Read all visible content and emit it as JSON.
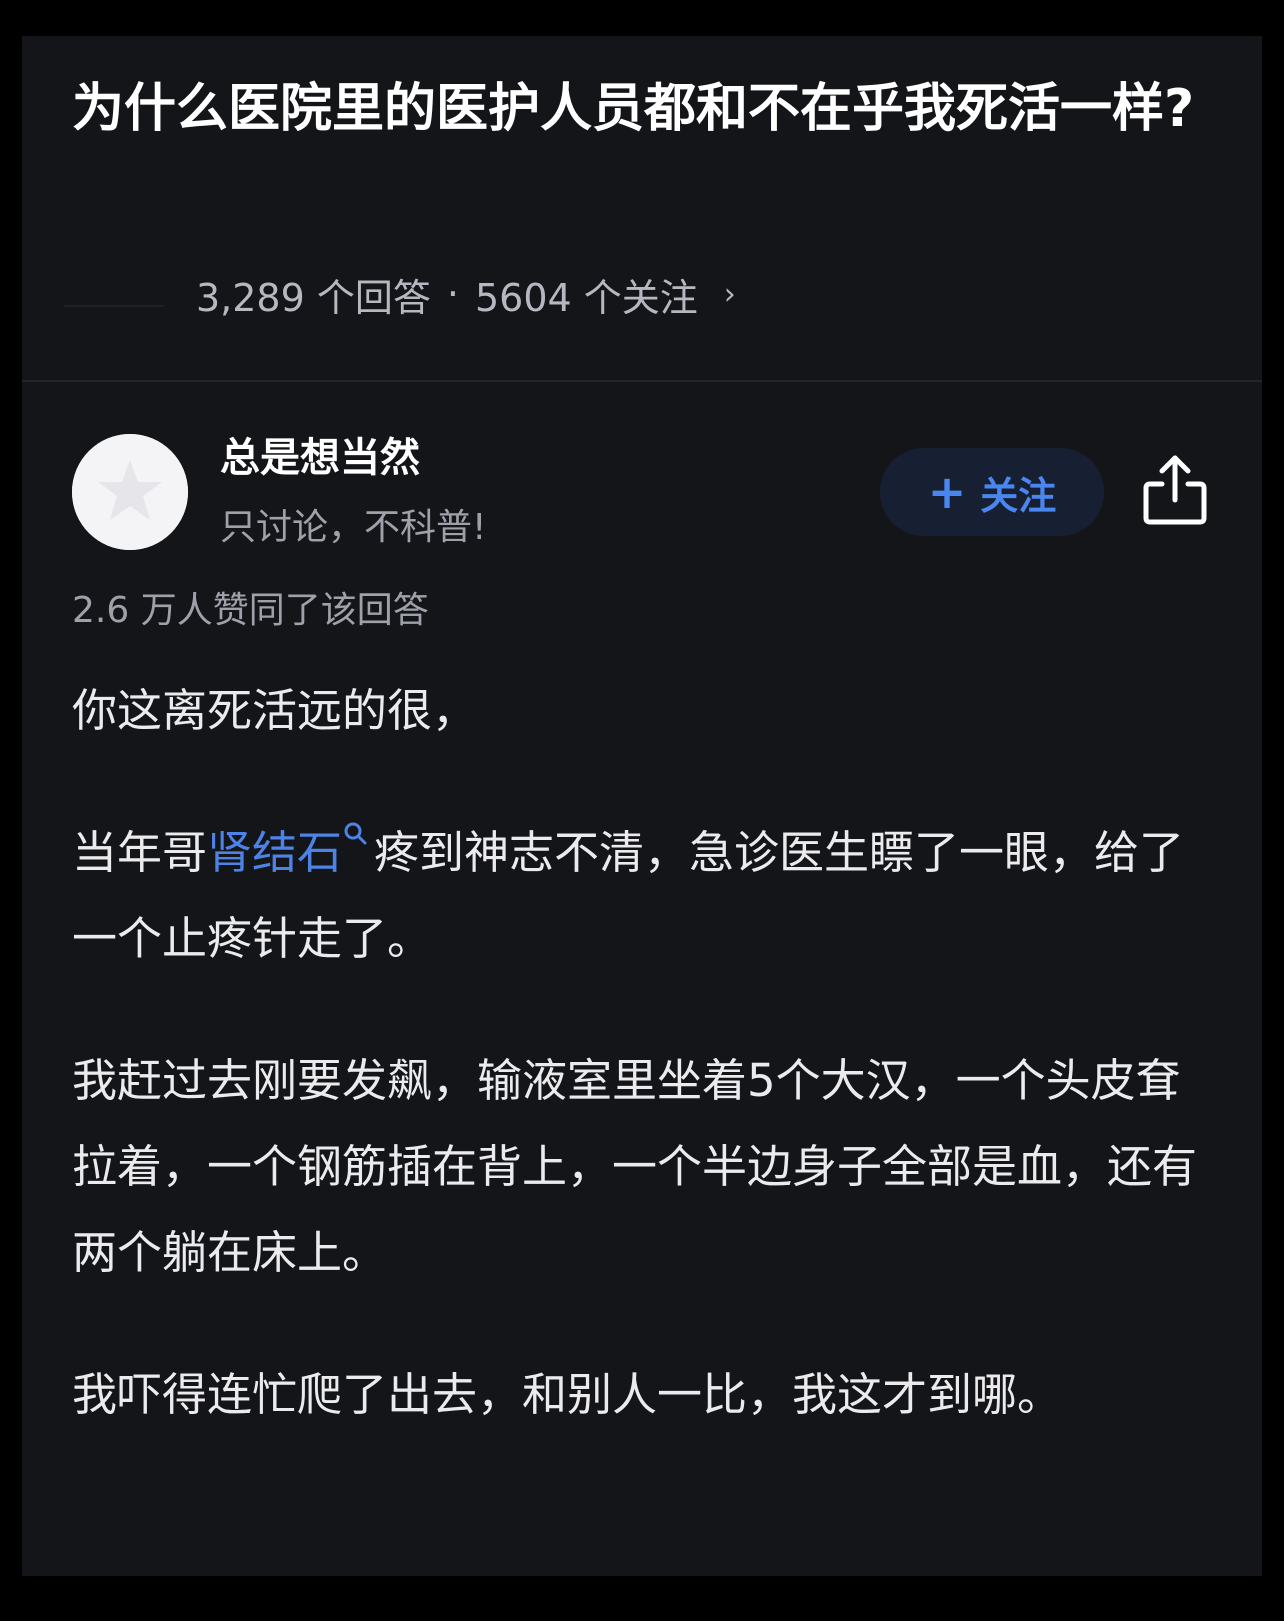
{
  "question": {
    "title": "为什么医院里的医护人员都和不在乎我死活一样?",
    "answers_count": "3,289 个回答",
    "separator": "·",
    "followers_count": "5604 个关注",
    "chevron": "›"
  },
  "answer": {
    "author": {
      "name": "总是想当然",
      "bio": "只讨论，不科普!",
      "avatar_icon": "star-avatar-icon"
    },
    "follow_button": {
      "plus": "+",
      "label": "关注"
    },
    "share_icon": "share-icon",
    "upvote_text": "2.6 万人赞同了该回答",
    "paragraphs": {
      "p1": "你这离死活远的很，",
      "p2_before": "当年哥",
      "p2_link": "肾结石",
      "p2_after": "疼到神志不清，急诊医生瞟了一眼，给了一个止疼针走了。",
      "p3": "我赶过去刚要发飙，输液室里坐着5个大汉，一个头皮耷拉着，一个钢筋插在背上，一个半边身子全部是血，还有两个躺在床上。",
      "p4": "我吓得连忙爬了出去，和别人一比，我这才到哪。"
    }
  },
  "colors": {
    "background": "#000000",
    "card": "#141519",
    "text_primary": "#ffffff",
    "text_secondary": "#9ea1a9",
    "link": "#4d82e6",
    "follow_button_bg": "#172033",
    "follow_button_text": "#4a86ef"
  }
}
